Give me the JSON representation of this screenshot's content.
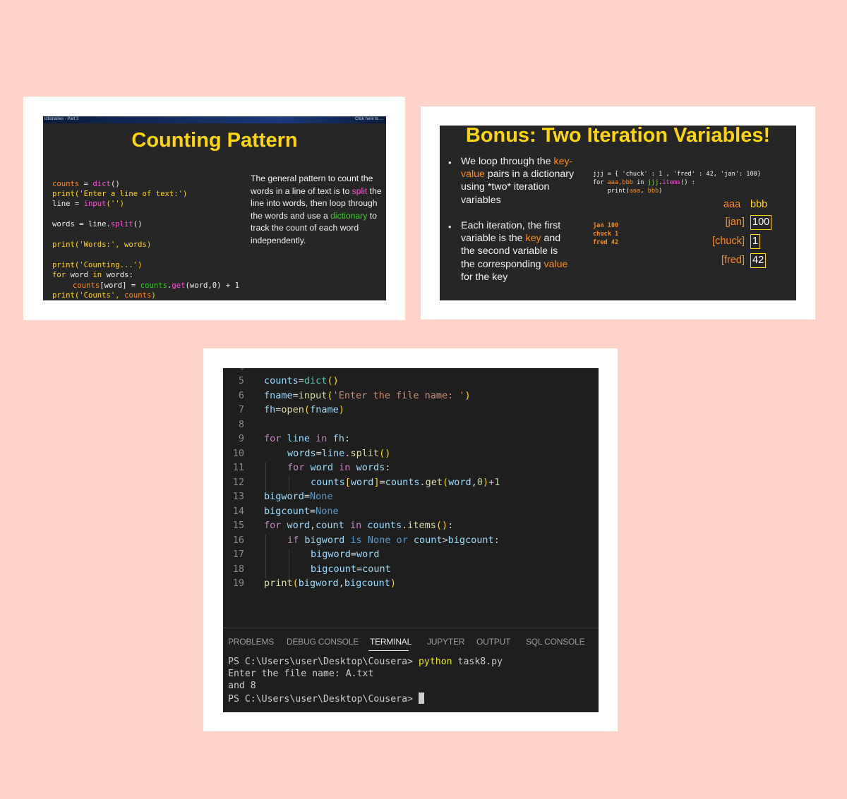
{
  "slide1": {
    "header_left": "ictionaries - Part 3",
    "header_right": "Click here to ...",
    "title": "Counting Pattern",
    "code": {
      "l1a": "counts",
      "l1b": " = ",
      "l1c": "dict",
      "l1d": "()",
      "l2a": "print",
      "l2b": "('Enter a line of text:')",
      "l3a": "line",
      "l3b": " = ",
      "l3c": "input",
      "l3d": "('')",
      "l4a": "words = line.",
      "l4b": "split",
      "l4c": "()",
      "l5a": "print",
      "l5b": "('Words:', words)",
      "l6a": "print",
      "l6b": "('Counting...')",
      "l7a": "for",
      "l7b": " word ",
      "l7c": "in",
      "l7d": " words:",
      "l8a": "counts",
      "l8b": "[word] = ",
      "l8c": "counts",
      "l8d": ".",
      "l8e": "get",
      "l8f": "(word,0) + 1",
      "l9a": "print",
      "l9b": "('Counts', ",
      "l9c": "counts",
      "l9d": ")"
    },
    "desc": {
      "p1": "The general pattern to count the words in a line of text is to ",
      "split": "split",
      "p2": " the line into words, then loop through the words and use a ",
      "dictionary": "dictionary",
      "p3": " to track the count of each word independently."
    }
  },
  "slide2": {
    "title": "Bonus: Two Iteration Variables!",
    "b1": {
      "a": "We loop through the ",
      "kv": "key-value",
      "b": " pairs in a dictionary using *two* iteration variables"
    },
    "b2": {
      "a": "Each iteration, the first variable is the ",
      "key": "key",
      "b": " and the second variable is the corresponding ",
      "value": "value",
      "c": " for the key"
    },
    "code": {
      "l1": "jjj = { 'chuck' : 1 , 'fred' : 42, 'jan': 100}",
      "l2a": "for ",
      "l2b": "aaa,bbb",
      "l2c": " in ",
      "l2d": "jjj",
      "l2e": ".",
      "l2f": "items",
      "l2g": "() :",
      "l3a": "    print(",
      "l3b": "aaa",
      "l3c": ", ",
      "l3d": "bbb",
      "l3e": ")"
    },
    "output": [
      "jan 100",
      "chuck 1",
      "fred 42"
    ],
    "head_aaa": "aaa",
    "head_bbb": "bbb",
    "rows": [
      {
        "key": "[jan]",
        "val": "100"
      },
      {
        "key": "[chuck]",
        "val": "1"
      },
      {
        "key": "[fred]",
        "val": "42"
      }
    ]
  },
  "editor": {
    "lines": [
      "5",
      "6",
      "7",
      "8",
      "9",
      "10",
      "11",
      "12",
      "13",
      "14",
      "15",
      "16",
      "17",
      "18",
      "19"
    ],
    "code": {
      "l5": [
        "counts",
        "=",
        "dict",
        "()"
      ],
      "l6": [
        "fname",
        "=",
        "input",
        "(",
        "'Enter the file name: '",
        ")"
      ],
      "l7": [
        "fh",
        "=",
        "open",
        "(",
        "fname",
        ")"
      ],
      "l9": [
        "for",
        " line ",
        "in",
        " fh",
        ":"
      ],
      "l10": [
        "words",
        "=",
        "line",
        ".",
        "split",
        "()"
      ],
      "l11": [
        "for",
        " word ",
        "in",
        " words",
        ":"
      ],
      "l12": [
        "counts",
        "[",
        "word",
        "]",
        "=",
        "counts",
        ".",
        "get",
        "(",
        "word",
        ",",
        "0",
        ")",
        "+",
        "1"
      ],
      "l13": [
        "bigword",
        "=",
        "None"
      ],
      "l14": [
        "bigcount",
        "=",
        "None"
      ],
      "l15": [
        "for",
        " word",
        ",",
        "count",
        " in ",
        "counts",
        ".",
        "items",
        "()",
        ":"
      ],
      "l16": [
        "if",
        " bigword ",
        "is",
        " None ",
        "or",
        " count",
        ">",
        "bigcount",
        ":"
      ],
      "l17": [
        "bigword",
        "=",
        "word"
      ],
      "l18": [
        "bigcount",
        "=",
        "count"
      ],
      "l19": [
        "print",
        "(",
        "bigword",
        ",",
        "bigcount",
        ")"
      ]
    }
  },
  "panel": {
    "tabs": [
      "PROBLEMS",
      "DEBUG CONSOLE",
      "TERMINAL",
      "JUPYTER",
      "OUTPUT",
      "SQL CONSOLE"
    ],
    "active_tab": "TERMINAL",
    "terminal": {
      "prompt1": "PS C:\\Users\\user\\Desktop\\Cousera> ",
      "cmd": "python",
      "arg": " task8.py",
      "line2": "Enter the file name: A.txt",
      "line3": "and 8",
      "prompt2": "PS C:\\Users\\user\\Desktop\\Cousera> "
    }
  }
}
